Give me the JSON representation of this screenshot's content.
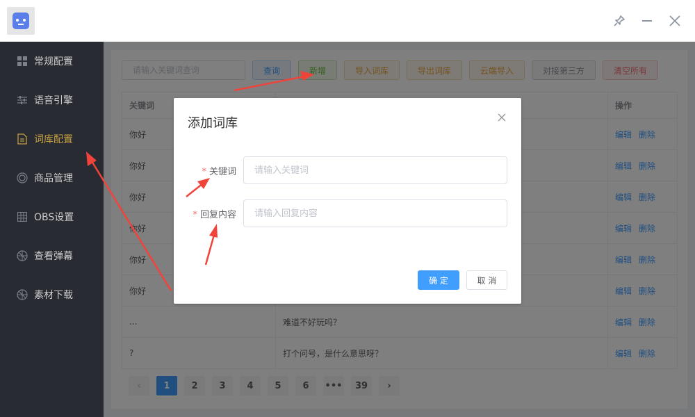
{
  "sidebar": {
    "items": [
      {
        "label": "常规配置",
        "icon": "grid-icon"
      },
      {
        "label": "语音引擎",
        "icon": "sliders-icon"
      },
      {
        "label": "词库配置",
        "icon": "document-icon"
      },
      {
        "label": "商品管理",
        "icon": "target-icon"
      },
      {
        "label": "OBS设置",
        "icon": "table-icon"
      },
      {
        "label": "查看弹幕",
        "icon": "aperture-icon"
      },
      {
        "label": "素材下载",
        "icon": "aperture-icon"
      }
    ],
    "active_index": 2
  },
  "toolbar": {
    "search_placeholder": "请输入关键词查询",
    "query": "查询",
    "add": "新增",
    "import": "导入词库",
    "export": "导出词库",
    "cloud_import": "云端导入",
    "third_party": "对接第三方",
    "clear_all": "清空所有"
  },
  "table": {
    "headers": {
      "keyword": "关键词",
      "reply": "",
      "action": "操作"
    },
    "rows": [
      {
        "keyword": "你好",
        "reply": ""
      },
      {
        "keyword": "你好",
        "reply": ""
      },
      {
        "keyword": "你好",
        "reply": ""
      },
      {
        "keyword": "你好",
        "reply": ""
      },
      {
        "keyword": "你好",
        "reply": ""
      },
      {
        "keyword": "你好",
        "reply": ""
      },
      {
        "keyword": "...",
        "reply": "难道不好玩吗？"
      },
      {
        "keyword": "?",
        "reply": "打个问号，是什么意思呀？"
      }
    ],
    "edit": "编辑",
    "delete": "删除"
  },
  "pagination": {
    "prev": "‹",
    "pages": [
      "1",
      "2",
      "3",
      "4",
      "5",
      "6",
      "•••",
      "39"
    ],
    "next": "›",
    "current": "1"
  },
  "dialog": {
    "title": "添加词库",
    "keyword_label": "关键词",
    "keyword_placeholder": "请输入关键词",
    "reply_label": "回复内容",
    "reply_placeholder": "请输入回复内容",
    "required_mark": "*",
    "ok": "确 定",
    "cancel": "取 消"
  },
  "colors": {
    "primary": "#409eff",
    "sidebar_bg": "#2e3138",
    "active_menu": "#e2b64a",
    "arrow": "#f0443b"
  }
}
